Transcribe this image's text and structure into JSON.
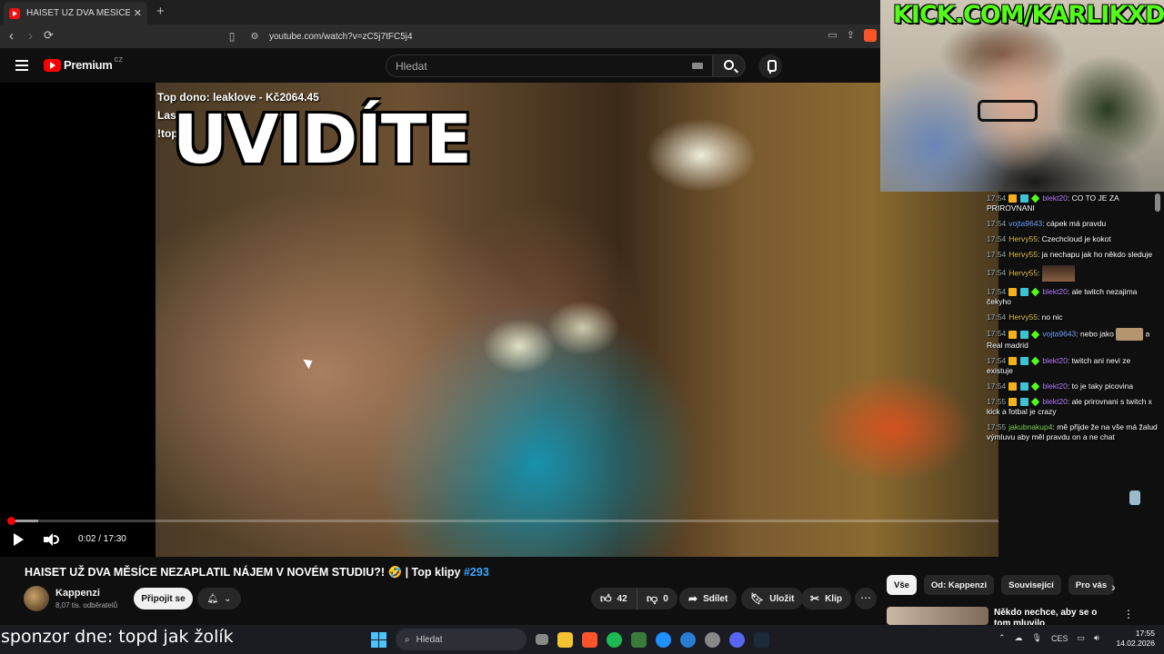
{
  "browser": {
    "tab_title": "HAISET UŽ DVA MĚSÍCE NEZAPL",
    "tab_close": "✕",
    "new_tab": "+",
    "url": "youtube.com/watch?v=zC5j7tFC5j4"
  },
  "youtube": {
    "logo_word": "Premium",
    "logo_country": "CZ",
    "search_placeholder": "Hledat"
  },
  "video_overlay": {
    "top_dono": "Top dono: leaklove - Kč2064.45",
    "line2": "Las",
    "line3": "!top",
    "caption": "UVIDÍTE"
  },
  "player": {
    "time": "0:02 / 17:30",
    "progress_fraction": 0.0019
  },
  "stream": {
    "kick_url": "KICK.COM/KARLIKXD"
  },
  "chat": [
    {
      "time": "17:54",
      "user": "blekt20",
      "user_color": "#b980ff",
      "badges": true,
      "text": "CO TO JE ZA PRIROVNANI"
    },
    {
      "time": "17:54",
      "user": "vojta9643",
      "user_color": "#72a6ff",
      "badges": false,
      "text": "cápek má pravdu"
    },
    {
      "time": "17:54",
      "user": "Hervy55",
      "user_color": "#e0c050",
      "badges": false,
      "text": "Czechcloud je kokot"
    },
    {
      "time": "17:54",
      "user": "Hervy55",
      "user_color": "#e0c050",
      "badges": false,
      "text": "ja nechapu jak ho někdo sleduje"
    },
    {
      "time": "17:54",
      "user": "Hervy55",
      "user_color": "#e0c050",
      "badges": false,
      "text": "",
      "emote": true
    },
    {
      "time": "17:54",
      "user": "blekt20",
      "user_color": "#b980ff",
      "badges": true,
      "text": "ale twitch nezajima čekyho"
    },
    {
      "time": "17:54",
      "user": "Hervy55",
      "user_color": "#e0c050",
      "badges": false,
      "text": "no nic"
    },
    {
      "time": "17:54",
      "user": "vojta9643",
      "user_color": "#72a6ff",
      "badges": true,
      "text": "nebo jako",
      "emote_mid": true,
      "text_after": "a Real madrid"
    },
    {
      "time": "17:54",
      "user": "blekt20",
      "user_color": "#b980ff",
      "badges": true,
      "text": "twitch ani nevi ze existuje"
    },
    {
      "time": "17:54",
      "user": "blekt20",
      "user_color": "#b980ff",
      "badges": true,
      "text": "to je taky picovina"
    },
    {
      "time": "17:55",
      "user": "blekt20",
      "user_color": "#b980ff",
      "badges": true,
      "text": "ale prirovnani s twitch x kick a fotbal je crazy"
    },
    {
      "time": "17:55",
      "user": "jakubnakup4",
      "user_color": "#7ed957",
      "badges": false,
      "text": "mě přijde že na vše má žalud výmluvu aby měl pravdu on a ne chat"
    }
  ],
  "video_info": {
    "title": "HAISET UŽ DVA MĚSÍCE NEZAPLATIL NÁJEM V NOVÉM STUDIU?! 🤣 | Top klipy",
    "title_tag": "#293",
    "channel": "Kappenzi",
    "subscribers": "8,07 tis. odběratelů",
    "join_label": "Připojit se",
    "likes": "42",
    "dislikes": "0",
    "share_label": "Sdílet",
    "save_label": "Uložit",
    "clip_label": "Klip",
    "more": "⋯"
  },
  "recommendations": {
    "chips": [
      "Vše",
      "Od: Kappenzi",
      "Související",
      "Pro vás"
    ],
    "first_title": "Někdo nechce, aby se o tom mluvilo"
  },
  "sponsor_text": "sponzor dne: topd jak žolík",
  "taskbar": {
    "search_placeholder": "Hledat",
    "lang": "CES",
    "time": "17:55",
    "date": "14.02.2026"
  },
  "colors": {
    "yt_red": "#ff0000",
    "kick_green": "#53fc18",
    "link_blue": "#3ea6ff"
  }
}
